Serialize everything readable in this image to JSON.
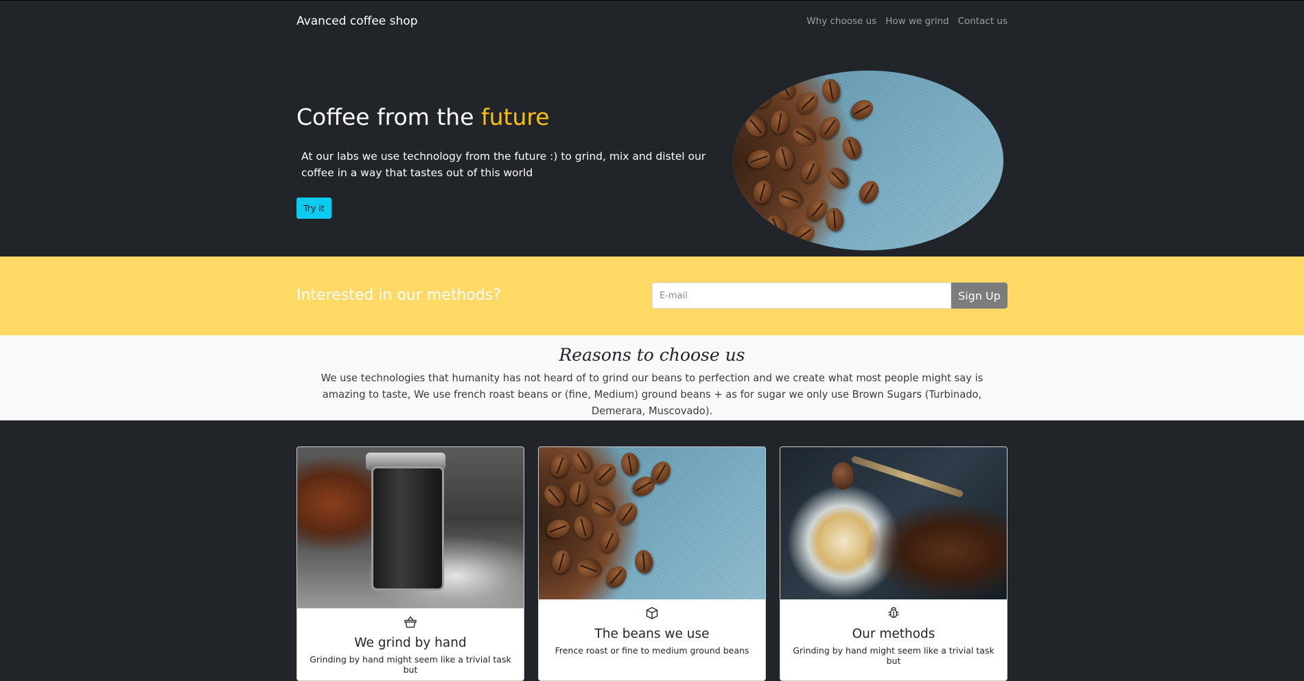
{
  "nav": {
    "brand": "Avanced coffee shop",
    "links": [
      "Why choose us",
      "How we grind",
      "Contact us"
    ]
  },
  "hero": {
    "title_main": "Coffee from the ",
    "title_accent": "future",
    "text": "At our labs we use technology from the future :) to grind, mix and distel our coffee in a way that tastes out of this world",
    "button": "Try it"
  },
  "signup": {
    "title": "Interested in our methods?",
    "placeholder": "E-mail",
    "button": "Sign Up"
  },
  "reasons": {
    "title": "Reasons to choose us",
    "text": "We use technologies that humanity has not heard of to grind our beans to perfection and we create what most people might say is amazing to taste, We use french roast beans or (fine, Medium) ground beans + as for sugar we only use Brown Sugars (Turbinado, Demerara, Muscovado)."
  },
  "cards": [
    {
      "icon": "basket-icon",
      "title": "We grind by hand",
      "text": "Grinding by hand might seem like a trivial task but"
    },
    {
      "icon": "box-icon",
      "title": "The beans we use",
      "text": "Frence roast or fine to medium ground beans"
    },
    {
      "icon": "bug-icon",
      "title": "Our methods",
      "text": "Grinding by hand might seem like a trivial task but"
    }
  ],
  "colors": {
    "dark_bg": "#212529",
    "accent": "#ffc107",
    "signup_band": "#ffd966",
    "try_button": "#0dcaf0",
    "signup_button": "#7c7c7c",
    "light_section": "#f8f9fa"
  }
}
